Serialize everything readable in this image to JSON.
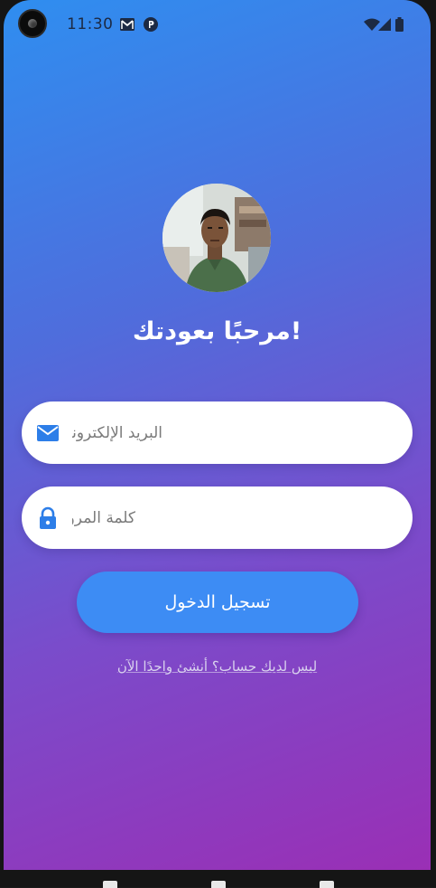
{
  "status_bar": {
    "time": "11:30",
    "icons": [
      "camera-icon",
      "gmail-icon",
      "p-icon",
      "wifi-icon",
      "signal-icon",
      "battery-icon"
    ]
  },
  "login": {
    "avatar_alt": "profile photo",
    "welcome_title": "!مرحبًا بعودتك",
    "email_placeholder": "البريد الإلكتروني",
    "email_value": "",
    "password_placeholder": "كلمة المرور",
    "password_value": "",
    "login_button": "تسجيل الدخول",
    "signup_link": "ليس لديك حساب؟ أنشئ واحدًا الآن"
  },
  "colors": {
    "gradient_top": "#2f8ef0",
    "gradient_bottom": "#9a2fb5",
    "accent": "#3d8cf4",
    "field_bg": "#ffffff"
  }
}
